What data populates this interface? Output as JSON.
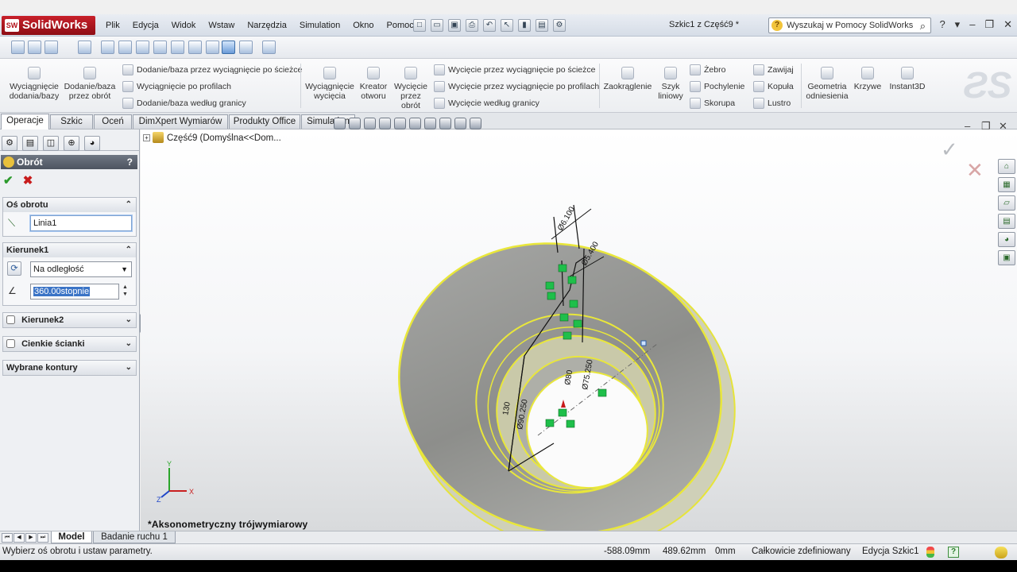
{
  "app": {
    "name": "SolidWorks",
    "logo_mark": "SW",
    "doc_title": "Szkic1 z Część9 *"
  },
  "menu": [
    "Plik",
    "Edycja",
    "Widok",
    "Wstaw",
    "Narzędzia",
    "Simulation",
    "Okno",
    "Pomoc"
  ],
  "search": {
    "placeholder": "Wyszukaj w Pomocy SolidWorks",
    "icon": "search-icon"
  },
  "window_buttons": [
    "?",
    "▾",
    "–",
    "❐",
    "✕"
  ],
  "commands": {
    "extrude_boss": "Wyciągnięcie dodania/bazy",
    "revolve_boss": "Dodanie/baza przez obrót",
    "sweep_boss": "Dodanie/baza przez wyciągnięcie po ścieżce",
    "loft_boss": "Wyciągnięcie po profilach",
    "boundary_boss": "Dodanie/baza według granicy",
    "extrude_cut": "Wyciągnięcie wycięcia",
    "hole_wizard": "Kreator otworu",
    "revolve_cut": "Wycięcie przez obrót",
    "sweep_cut": "Wycięcie przez wyciągnięcie po ścieżce",
    "loft_cut": "Wycięcie przez wyciągnięcie po profilach",
    "boundary_cut": "Wycięcie według granicy",
    "fillet": "Zaokrąglenie",
    "linear_pattern": "Szyk liniowy",
    "rib": "Żebro",
    "draft": "Pochylenie",
    "shell": "Skorupa",
    "wrap": "Zawijaj",
    "dome": "Kopuła",
    "mirror": "Lustro",
    "ref_geometry": "Geometria odniesienia",
    "curves": "Krzywe",
    "instant3d": "Instant3D"
  },
  "tabs": [
    "Operacje",
    "Szkic",
    "Oceń",
    "DimXpert Wymiarów",
    "Produkty Office",
    "Simulation"
  ],
  "active_tab": "Operacje",
  "property_manager": {
    "title": "Obrót",
    "help": "?",
    "axis_group": {
      "label": "Oś obrotu",
      "value": "Linia1"
    },
    "direction1": {
      "label": "Kierunek1",
      "type": "Na odległość",
      "angle": "360.00stopnie"
    },
    "direction2": {
      "label": "Kierunek2"
    },
    "thin": {
      "label": "Cienkie ścianki"
    },
    "contours": {
      "label": "Wybrane kontury"
    }
  },
  "tree": {
    "root": "Część9  (Domyślna<<Dom..."
  },
  "viewport": {
    "view_label": "*Aksonometryczny trójwymiarowy",
    "dimensions": [
      "Ø6.100",
      "Ø5.400",
      "130",
      "Ø90.250",
      "Ø80",
      "Ø75.250"
    ],
    "triad": {
      "x": "X",
      "y": "Y",
      "z": "Z"
    }
  },
  "bottom_tabs": [
    "Model",
    "Badanie ruchu 1"
  ],
  "status": {
    "message": "Wybierz oś obrotu i ustaw parametry.",
    "x": "-588.09mm",
    "y": "489.62mm",
    "z": "0mm",
    "state": "Całkowicie zdefiniowany",
    "mode": "Edycja Szkic1"
  },
  "colors": {
    "highlight": "#e9e73a",
    "brand": "#b3121b",
    "relations": "#1fbf4a"
  }
}
